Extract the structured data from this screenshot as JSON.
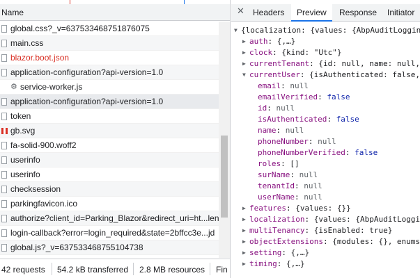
{
  "network": {
    "column_header": "Name",
    "requests": [
      {
        "name": "global.css?_v=637533468751876075",
        "icon": "file-icon",
        "style": "normal"
      },
      {
        "name": "main.css",
        "icon": "file-icon",
        "style": "normal"
      },
      {
        "name": "blazor.boot.json",
        "icon": "file-icon",
        "style": "error"
      },
      {
        "name": "application-configuration?api-version=1.0",
        "icon": "file-icon",
        "style": "normal"
      },
      {
        "name": "service-worker.js",
        "icon": "gear-icon",
        "style": "normal"
      },
      {
        "name": "application-configuration?api-version=1.0",
        "icon": "file-icon",
        "style": "selected"
      },
      {
        "name": "token",
        "icon": "file-icon",
        "style": "normal"
      },
      {
        "name": "gb.svg",
        "icon": "svg-flag-icon",
        "style": "normal"
      },
      {
        "name": "fa-solid-900.woff2",
        "icon": "file-icon",
        "style": "normal"
      },
      {
        "name": "userinfo",
        "icon": "file-icon",
        "style": "normal"
      },
      {
        "name": "userinfo",
        "icon": "file-icon",
        "style": "normal"
      },
      {
        "name": "checksession",
        "icon": "file-icon",
        "style": "normal"
      },
      {
        "name": "parkingfavicon.ico",
        "icon": "file-icon",
        "style": "normal"
      },
      {
        "name": "authorize?client_id=Parking_Blazor&redirect_uri=ht...len",
        "icon": "file-icon",
        "style": "normal"
      },
      {
        "name": "login-callback?error=login_required&state=2bffcc3e...jd",
        "icon": "file-icon",
        "style": "normal"
      },
      {
        "name": "global.js?_v=637533468755104738",
        "icon": "file-icon",
        "style": "normal"
      }
    ],
    "status": {
      "requests": "42 requests",
      "transferred": "54.2 kB transferred",
      "resources": "2.8 MB resources",
      "finish": "Fin"
    }
  },
  "details": {
    "close_glyph": "✕",
    "tabs": [
      {
        "label": "Headers",
        "active": false
      },
      {
        "label": "Preview",
        "active": true
      },
      {
        "label": "Response",
        "active": false
      },
      {
        "label": "Initiator",
        "active": false
      }
    ],
    "tree": [
      {
        "level": 0,
        "expander": "expanded",
        "key": "",
        "text": "{localization: {values: {AbpAuditLogging"
      },
      {
        "level": 1,
        "expander": "collapsed",
        "key": "auth",
        "text": "{,…}"
      },
      {
        "level": 1,
        "expander": "collapsed",
        "key": "clock",
        "text": "{kind: \"Utc\"}"
      },
      {
        "level": 1,
        "expander": "collapsed",
        "key": "currentTenant",
        "text": "{id: null, name: null,"
      },
      {
        "level": 1,
        "expander": "expanded",
        "key": "currentUser",
        "text": "{isAuthenticated: false,"
      },
      {
        "level": 2,
        "expander": "none",
        "key": "email",
        "text": "null",
        "kind": "null"
      },
      {
        "level": 2,
        "expander": "none",
        "key": "emailVerified",
        "text": "false",
        "kind": "bool"
      },
      {
        "level": 2,
        "expander": "none",
        "key": "id",
        "text": "null",
        "kind": "null"
      },
      {
        "level": 2,
        "expander": "none",
        "key": "isAuthenticated",
        "text": "false",
        "kind": "bool"
      },
      {
        "level": 2,
        "expander": "none",
        "key": "name",
        "text": "null",
        "kind": "null"
      },
      {
        "level": 2,
        "expander": "none",
        "key": "phoneNumber",
        "text": "null",
        "kind": "null"
      },
      {
        "level": 2,
        "expander": "none",
        "key": "phoneNumberVerified",
        "text": "false",
        "kind": "bool"
      },
      {
        "level": 2,
        "expander": "none",
        "key": "roles",
        "text": "[]",
        "kind": "plain"
      },
      {
        "level": 2,
        "expander": "none",
        "key": "surName",
        "text": "null",
        "kind": "null"
      },
      {
        "level": 2,
        "expander": "none",
        "key": "tenantId",
        "text": "null",
        "kind": "null"
      },
      {
        "level": 2,
        "expander": "none",
        "key": "userName",
        "text": "null",
        "kind": "null"
      },
      {
        "level": 1,
        "expander": "collapsed",
        "key": "features",
        "text": "{values: {}}"
      },
      {
        "level": 1,
        "expander": "collapsed",
        "key": "localization",
        "text": "{values: {AbpAuditLoggin"
      },
      {
        "level": 1,
        "expander": "collapsed",
        "key": "multiTenancy",
        "text": "{isEnabled: true}"
      },
      {
        "level": 1,
        "expander": "collapsed",
        "key": "objectExtensions",
        "text": "{modules: {}, enums"
      },
      {
        "level": 1,
        "expander": "collapsed",
        "key": "setting",
        "text": "{,…}"
      },
      {
        "level": 1,
        "expander": "collapsed",
        "key": "timing",
        "text": "{,…}"
      }
    ]
  },
  "colors": {
    "selected_row": "#e8eaed",
    "error_text": "#d93025",
    "active_tab_underline": "#1a73e8",
    "json_key": "#881280"
  }
}
